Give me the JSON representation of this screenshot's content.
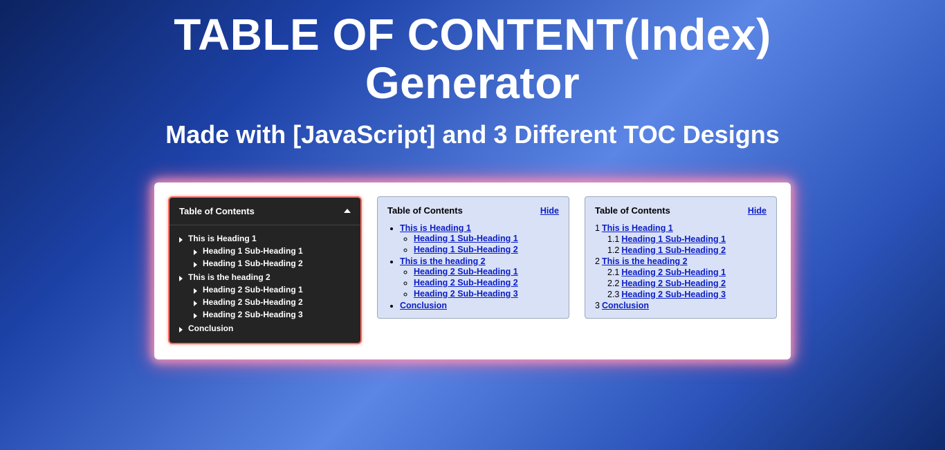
{
  "title_line1": "TABLE OF CONTENT(Index)",
  "title_line2": "Generator",
  "subtitle": "Made with [JavaScript] and 3 Different TOC Designs",
  "toc_title": "Table of Contents",
  "hide_label": "Hide",
  "items": [
    {
      "label": "This is Heading 1",
      "subs": [
        {
          "label": "Heading 1 Sub-Heading 1"
        },
        {
          "label": "Heading 1 Sub-Heading 2"
        }
      ]
    },
    {
      "label": "This is the heading 2",
      "subs": [
        {
          "label": "Heading 2 Sub-Heading 1"
        },
        {
          "label": "Heading 2 Sub-Heading 2"
        },
        {
          "label": "Heading 2 Sub-Heading 3"
        }
      ]
    },
    {
      "label": "Conclusion",
      "subs": []
    }
  ],
  "numbered": [
    {
      "num": "1",
      "label": "This is Heading 1",
      "sub": false
    },
    {
      "num": "1.1",
      "label": "Heading 1 Sub-Heading 1",
      "sub": true
    },
    {
      "num": "1.2",
      "label": "Heading 1 Sub-Heading 2",
      "sub": true
    },
    {
      "num": "2",
      "label": "This is the heading 2",
      "sub": false
    },
    {
      "num": "2.1",
      "label": "Heading 2 Sub-Heading 1",
      "sub": true
    },
    {
      "num": "2.2",
      "label": "Heading 2 Sub-Heading 2",
      "sub": true
    },
    {
      "num": "2.3",
      "label": "Heading 2 Sub-Heading 3",
      "sub": true
    },
    {
      "num": "3",
      "label": "Conclusion",
      "sub": false
    }
  ]
}
